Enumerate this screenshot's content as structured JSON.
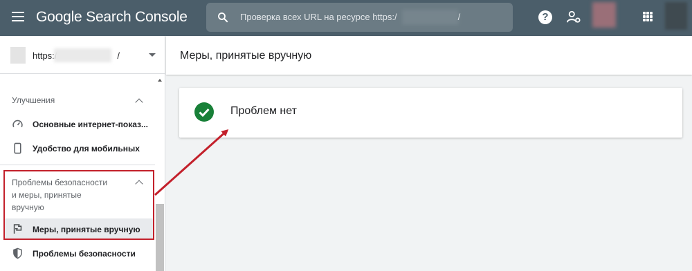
{
  "topbar": {
    "title": "Google Search Console",
    "search_placeholder": "Проверка всех URL на ресурсе https:/",
    "search_suffix": "/",
    "help_glyph": "?"
  },
  "sidebar": {
    "property_url": "https:/",
    "property_suffix": "/",
    "section_improvements": "Улучшения",
    "items_improvements": [
      {
        "label": "Основные интернет-показ...",
        "icon": "gauge-icon"
      },
      {
        "label": "Удобство для мобильных",
        "icon": "phone-icon"
      }
    ],
    "section_security_lines": [
      "Проблемы безопасности",
      "и меры, принятые",
      "вручную"
    ],
    "items_security": [
      {
        "label": "Меры, принятые вручную",
        "icon": "flag-icon",
        "active": true
      },
      {
        "label": "Проблемы безопасности",
        "icon": "shield-icon"
      }
    ]
  },
  "main": {
    "page_title": "Меры, принятые вручную",
    "status_text": "Проблем нет"
  },
  "colors": {
    "topbar": "#4b5e6a",
    "success": "#188038",
    "highlight": "#c3202b"
  }
}
